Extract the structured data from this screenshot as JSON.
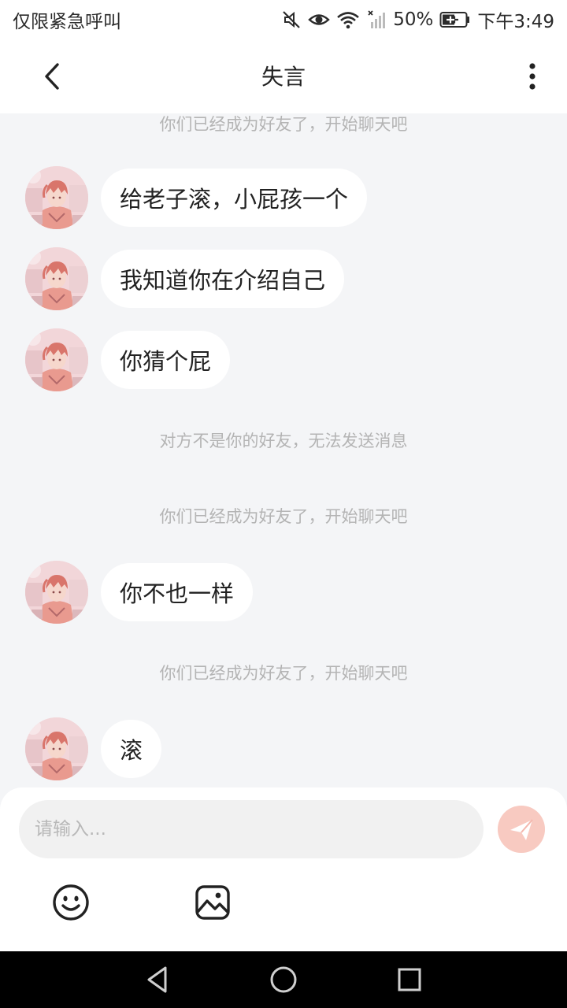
{
  "status_bar": {
    "left_text": "仅限紧急呼叫",
    "battery": "50%",
    "time": "下午3:49",
    "icons": [
      "mute-icon",
      "eye-icon",
      "wifi-icon",
      "signal-icon",
      "battery-icon"
    ]
  },
  "header": {
    "title": "失言",
    "icons": [
      "back-icon",
      "more-icon"
    ]
  },
  "chat": {
    "top_notice": "你们已经成为好友了，开始聊天吧",
    "messages": [
      {
        "text": "给老子滚，小屁孩一个"
      },
      {
        "text": "我知道你在介绍自己"
      },
      {
        "text": "你猜个屁"
      },
      {
        "text": "你不也一样"
      },
      {
        "text": "滚"
      }
    ],
    "notices": [
      "对方不是你的好友，无法发送消息",
      "你们已经成为好友了，开始聊天吧",
      "你们已经成为好友了，开始聊天吧"
    ]
  },
  "input": {
    "placeholder": "请输入...",
    "value": "",
    "icons": [
      "send-icon",
      "emoji-icon",
      "image-icon"
    ]
  },
  "colors": {
    "accent": "#f4b7ae",
    "background": "#f4f5f7",
    "bubble": "#ffffff",
    "notice_text": "#b4b4b4"
  }
}
